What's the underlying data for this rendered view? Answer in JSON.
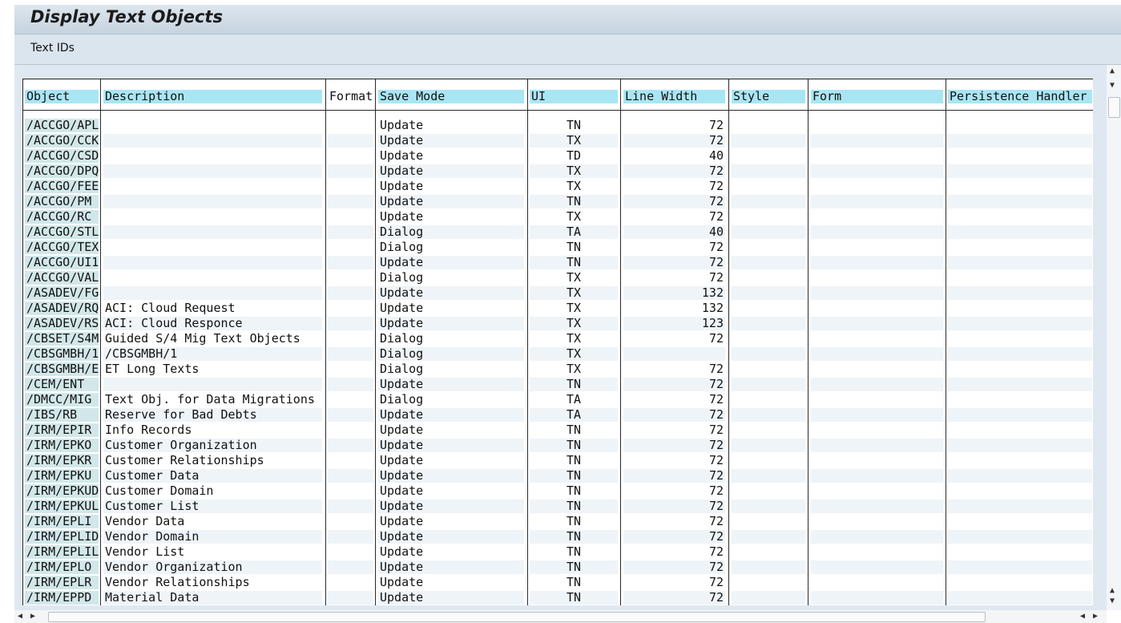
{
  "window": {
    "title": "Display Text Objects"
  },
  "toolbar": {
    "text_ids_label": "Text IDs"
  },
  "table": {
    "headers": {
      "object": "Object",
      "description": "Description",
      "format": "Format",
      "save_mode": "Save Mode",
      "ui": "UI",
      "line_width": "Line Width",
      "style": "Style",
      "form": "Form",
      "persistence_handler": "Persistence Handler"
    },
    "rows": [
      {
        "object": "/ACCGO/APL",
        "description": "",
        "save_mode": "Update",
        "ui": "TN",
        "line_width": "72"
      },
      {
        "object": "/ACCGO/CCK",
        "description": "",
        "save_mode": "Update",
        "ui": "TX",
        "line_width": "72"
      },
      {
        "object": "/ACCGO/CSD",
        "description": "",
        "save_mode": "Update",
        "ui": "TD",
        "line_width": "40"
      },
      {
        "object": "/ACCGO/DPQ",
        "description": "",
        "save_mode": "Update",
        "ui": "TX",
        "line_width": "72"
      },
      {
        "object": "/ACCGO/FEE",
        "description": "",
        "save_mode": "Update",
        "ui": "TX",
        "line_width": "72"
      },
      {
        "object": "/ACCGO/PM",
        "description": "",
        "save_mode": "Update",
        "ui": "TN",
        "line_width": "72"
      },
      {
        "object": "/ACCGO/RC",
        "description": "",
        "save_mode": "Update",
        "ui": "TX",
        "line_width": "72"
      },
      {
        "object": "/ACCGO/STL",
        "description": "",
        "save_mode": "Dialog",
        "ui": "TA",
        "line_width": "40"
      },
      {
        "object": "/ACCGO/TEX",
        "description": "",
        "save_mode": "Dialog",
        "ui": "TN",
        "line_width": "72"
      },
      {
        "object": "/ACCGO/UI1",
        "description": "",
        "save_mode": "Update",
        "ui": "TN",
        "line_width": "72"
      },
      {
        "object": "/ACCGO/VAL",
        "description": "",
        "save_mode": "Dialog",
        "ui": "TX",
        "line_width": "72"
      },
      {
        "object": "/ASADEV/FG",
        "description": "",
        "save_mode": "Update",
        "ui": "TX",
        "line_width": "132"
      },
      {
        "object": "/ASADEV/RQ",
        "description": "ACI: Cloud Request",
        "save_mode": "Update",
        "ui": "TX",
        "line_width": "132"
      },
      {
        "object": "/ASADEV/RS",
        "description": "ACI: Cloud Responce",
        "save_mode": "Update",
        "ui": "TX",
        "line_width": "123"
      },
      {
        "object": "/CBSET/S4M",
        "description": "Guided S/4 Mig Text Objects",
        "save_mode": "Dialog",
        "ui": "TX",
        "line_width": "72"
      },
      {
        "object": "/CBSGMBH/1",
        "description": "/CBSGMBH/1",
        "save_mode": "Dialog",
        "ui": "TX",
        "line_width": ""
      },
      {
        "object": "/CBSGMBH/E",
        "description": "ET Long Texts",
        "save_mode": "Dialog",
        "ui": "TX",
        "line_width": "72"
      },
      {
        "object": "/CEM/ENT",
        "description": "",
        "save_mode": "Update",
        "ui": "TN",
        "line_width": "72"
      },
      {
        "object": "/DMCC/MIG",
        "description": "Text Obj. for Data Migrations",
        "save_mode": "Dialog",
        "ui": "TA",
        "line_width": "72"
      },
      {
        "object": "/IBS/RB",
        "description": "Reserve for Bad Debts",
        "save_mode": "Update",
        "ui": "TA",
        "line_width": "72"
      },
      {
        "object": "/IRM/EPIR",
        "description": "Info Records",
        "save_mode": "Update",
        "ui": "TN",
        "line_width": "72"
      },
      {
        "object": "/IRM/EPKO",
        "description": "Customer Organization",
        "save_mode": "Update",
        "ui": "TN",
        "line_width": "72"
      },
      {
        "object": "/IRM/EPKR",
        "description": "Customer Relationships",
        "save_mode": "Update",
        "ui": "TN",
        "line_width": "72"
      },
      {
        "object": "/IRM/EPKU",
        "description": "Customer  Data",
        "save_mode": "Update",
        "ui": "TN",
        "line_width": "72"
      },
      {
        "object": "/IRM/EPKUD",
        "description": "Customer Domain",
        "save_mode": "Update",
        "ui": "TN",
        "line_width": "72"
      },
      {
        "object": "/IRM/EPKUL",
        "description": "Customer List",
        "save_mode": "Update",
        "ui": "TN",
        "line_width": "72"
      },
      {
        "object": "/IRM/EPLI",
        "description": "Vendor  Data",
        "save_mode": "Update",
        "ui": "TN",
        "line_width": "72"
      },
      {
        "object": "/IRM/EPLID",
        "description": "Vendor Domain",
        "save_mode": "Update",
        "ui": "TN",
        "line_width": "72"
      },
      {
        "object": "/IRM/EPLIL",
        "description": "Vendor List",
        "save_mode": "Update",
        "ui": "TN",
        "line_width": "72"
      },
      {
        "object": "/IRM/EPLO",
        "description": "Vendor Organization",
        "save_mode": "Update",
        "ui": "TN",
        "line_width": "72"
      },
      {
        "object": "/IRM/EPLR",
        "description": "Vendor Relationships",
        "save_mode": "Update",
        "ui": "TN",
        "line_width": "72"
      },
      {
        "object": "/IRM/EPPD",
        "description": "Material Data",
        "save_mode": "Update",
        "ui": "TN",
        "line_width": "72"
      }
    ]
  },
  "icons": {
    "scroll_up": "triangle-up",
    "scroll_down": "triangle-down",
    "scroll_left": "triangle-left",
    "scroll_right": "triangle-right"
  },
  "colors": {
    "header_bg": "#a9e6f3",
    "key_cell_bg": "#d2e7ea",
    "alt_row_bg": "#eef4f8",
    "frame_bg": "#dfe8f0"
  }
}
